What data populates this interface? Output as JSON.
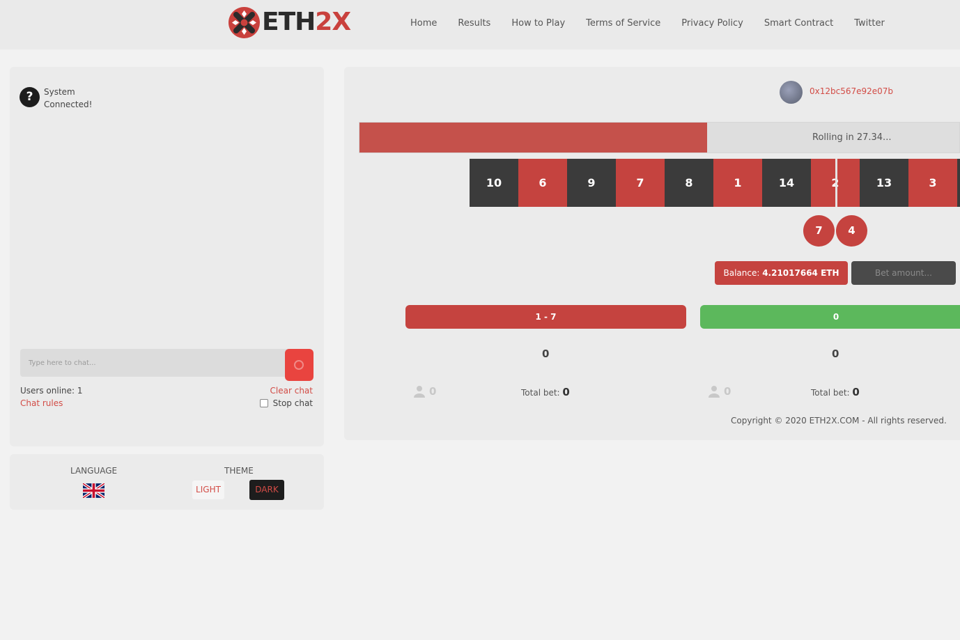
{
  "header": {
    "logo": {
      "text_main": "ETH",
      "text_accent": "2X"
    },
    "nav": [
      "Home",
      "Results",
      "How to Play",
      "Terms of Service",
      "Privacy Policy",
      "Smart Contract",
      "Twitter"
    ]
  },
  "chat": {
    "messages": [
      {
        "user": "System",
        "text": "Connected!",
        "avatar_glyph": "?"
      }
    ],
    "input_placeholder": "Type here to chat...",
    "users_online": "Users online: 1",
    "chat_rules": "Chat rules",
    "clear_chat": "Clear chat",
    "stop_chat": "Stop chat"
  },
  "settings": {
    "language_label": "LANGUAGE",
    "theme_label": "THEME",
    "light_label": "LIGHT",
    "dark_label": "DARK",
    "selected_theme": "dark"
  },
  "game": {
    "wallet_address": "0x12bc567e92e07b",
    "rolling_text": "Rolling in 27.34...",
    "rolling_progress": 0.58,
    "roll_tiles": [
      {
        "n": "10",
        "c": "black"
      },
      {
        "n": "6",
        "c": "red"
      },
      {
        "n": "9",
        "c": "black"
      },
      {
        "n": "7",
        "c": "red"
      },
      {
        "n": "8",
        "c": "black"
      },
      {
        "n": "1",
        "c": "red"
      },
      {
        "n": "14",
        "c": "black"
      },
      {
        "n": "2",
        "c": "red"
      },
      {
        "n": "13",
        "c": "black"
      },
      {
        "n": "3",
        "c": "red"
      },
      {
        "n": "",
        "c": "black"
      }
    ],
    "history": [
      "7",
      "4"
    ],
    "balance_label": "Balance: ",
    "balance_value": "4.21017664 ETH",
    "bet_placeholder": "Bet amount...",
    "bets": [
      {
        "label": "1 - 7",
        "amount": "0",
        "players": "0",
        "total_label": "Total bet: ",
        "total": "0",
        "color": "red"
      },
      {
        "label": "0",
        "amount": "0",
        "players": "0",
        "total_label": "Total bet: ",
        "total": "0",
        "color": "green"
      }
    ],
    "copyright": "Copyright © 2020 ETH2X.COM - All rights reserved."
  },
  "colors": {
    "accent": "#c5433f",
    "green": "#5cb85c",
    "dark": "#3b3b3b"
  }
}
